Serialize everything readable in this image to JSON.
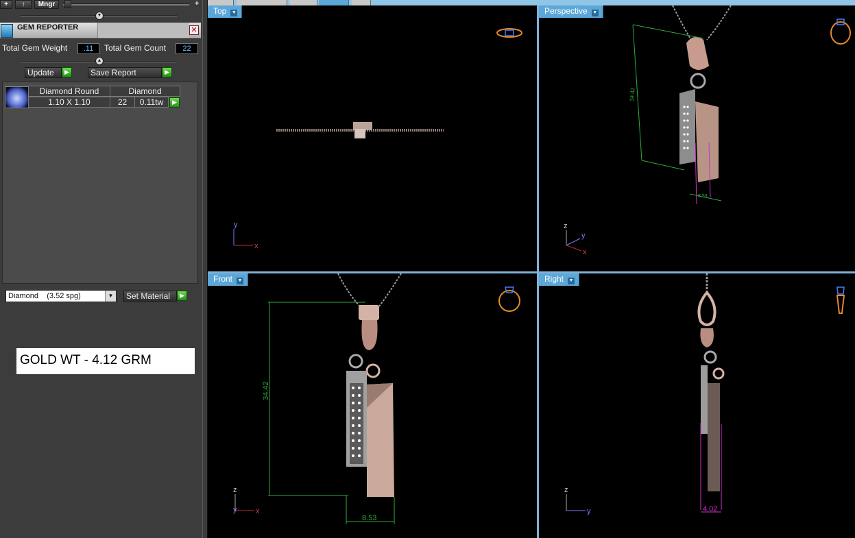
{
  "toolbar": {
    "mngr_label": "Mngr"
  },
  "gem_reporter": {
    "title": "GEM REPORTER",
    "total_gem_weight_label": "Total Gem Weight",
    "total_gem_weight": ".11",
    "total_gem_count_label": "Total Gem Count",
    "total_gem_count": "22",
    "update_label": "Update",
    "save_report_label": "Save Report",
    "gems": [
      {
        "shape": "Diamond Round",
        "material": "Diamond",
        "size": "1.10 X 1.10",
        "count": "22",
        "weight": "0.11tw"
      }
    ],
    "material_select": "Diamond    (3.52 spg)",
    "set_material_label": "Set Material"
  },
  "note": {
    "gold_weight": "GOLD WT - 4.12 GRM"
  },
  "viewports": {
    "top": {
      "label": "Top"
    },
    "perspective": {
      "label": "Perspective",
      "dim": "34.42",
      "dim2": "8.53"
    },
    "front": {
      "label": "Front",
      "height_dim": "34.42",
      "width_dim": "8.53"
    },
    "right": {
      "label": "Right",
      "depth_dim": "4.02"
    }
  },
  "colors": {
    "accent": "#5ca7d8",
    "dimension": "#2faa3a",
    "highlight": "#d030c8"
  }
}
